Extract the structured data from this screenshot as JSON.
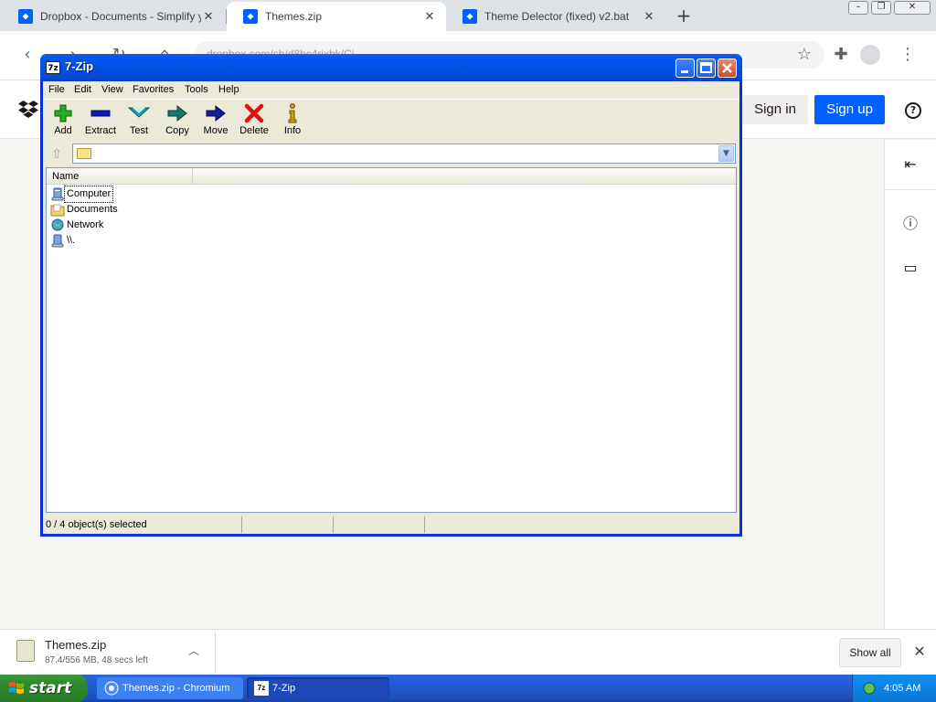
{
  "browser": {
    "tabs": [
      {
        "title": "Dropbox - Documents - Simplify your life",
        "active": false
      },
      {
        "title": "Themes.zip",
        "active": true
      },
      {
        "title": "Theme Delector (fixed) v2.bat",
        "active": false
      }
    ],
    "new_tab_symbol": "+",
    "address": "dropbox.com/sh/d8hc4rixbk/Ci...",
    "window_controls": {
      "minimize": "–",
      "restore": "❐",
      "close": "✕"
    }
  },
  "dropbox": {
    "sign_in_label": "Sign in",
    "sign_up_label": "Sign up",
    "help_symbol": "?"
  },
  "sevenzip": {
    "title": "7-Zip",
    "logo_text": "7z",
    "menu": [
      "File",
      "Edit",
      "View",
      "Favorites",
      "Tools",
      "Help"
    ],
    "toolbar": [
      {
        "label": "Add",
        "icon": "add-icon",
        "color": "#22b022"
      },
      {
        "label": "Extract",
        "icon": "extract-icon",
        "color": "#1018b8"
      },
      {
        "label": "Test",
        "icon": "test-icon",
        "color": "#10a8a8"
      },
      {
        "label": "Copy",
        "icon": "copy-icon",
        "color": "#0f7a6a"
      },
      {
        "label": "Move",
        "icon": "move-icon",
        "color": "#101e9a"
      },
      {
        "label": "Delete",
        "icon": "delete-icon",
        "color": "#e01010"
      },
      {
        "label": "Info",
        "icon": "info-icon",
        "color": "#c9a400"
      }
    ],
    "address_value": "",
    "column_header": "Name",
    "items": [
      {
        "name": "Computer",
        "icon": "computer-icon",
        "focused": true
      },
      {
        "name": "Documents",
        "icon": "documents-folder-icon",
        "focused": false
      },
      {
        "name": "Network",
        "icon": "network-icon",
        "focused": false
      },
      {
        "name": "\\\\.",
        "icon": "drive-icon",
        "focused": false
      }
    ],
    "status": "0 / 4 object(s) selected"
  },
  "download": {
    "file_name": "Themes.zip",
    "status": "87.4/556 MB, 48 secs left",
    "show_all_label": "Show all"
  },
  "taskbar": {
    "start_label": "start",
    "tasks": [
      "Themes.zip - Chromium",
      "7-Zip"
    ],
    "clock": "4:05 AM"
  }
}
